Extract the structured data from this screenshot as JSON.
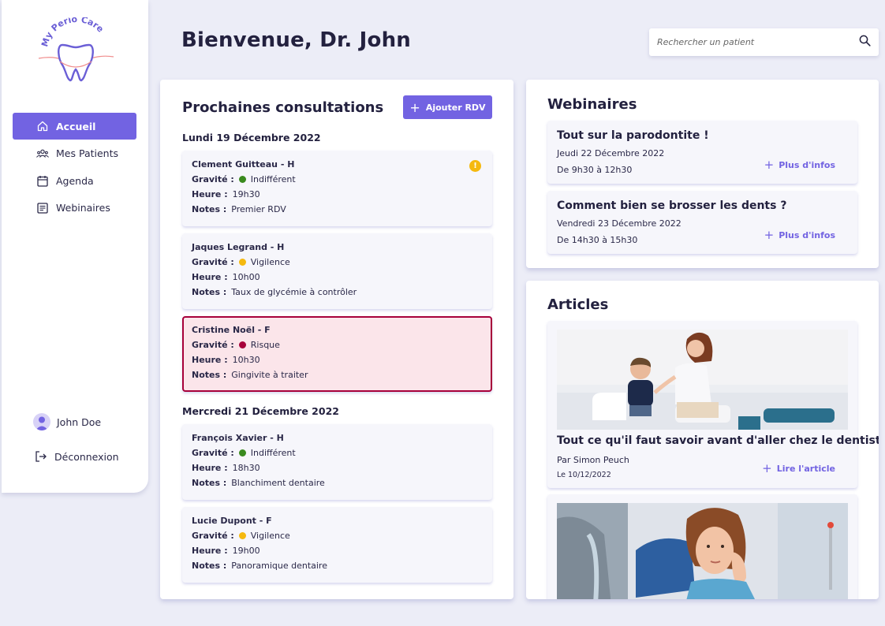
{
  "app": {
    "logo_text": "My Perio Care"
  },
  "sidebar": {
    "items": [
      {
        "label": "Accueil",
        "icon": "home-icon",
        "active": true
      },
      {
        "label": "Mes Patients",
        "icon": "patients-icon",
        "active": false
      },
      {
        "label": "Agenda",
        "icon": "calendar-icon",
        "active": false
      },
      {
        "label": "Webinaires",
        "icon": "document-icon",
        "active": false
      }
    ],
    "user_name": "John Doe",
    "logout_label": "Déconnexion"
  },
  "header": {
    "title": "Bienvenue, Dr. John",
    "search_placeholder": "Rechercher un patient"
  },
  "consultations": {
    "title": "Prochaines consultations",
    "add_button": "Ajouter RDV",
    "labels": {
      "gravity": "Gravité :",
      "hour": "Heure :",
      "notes": "Notes :"
    },
    "days": [
      {
        "label": "Lundi 19 Décembre 2022",
        "items": [
          {
            "name": "Clement Guitteau - H",
            "gravity": "Indifférent",
            "gravity_color": "#3a8a1e",
            "hour": "19h30",
            "notes": "Premier RDV",
            "warning": true
          },
          {
            "name": "Jaques Legrand - H",
            "gravity": "Vigilence",
            "gravity_color": "#f5b90f",
            "hour": "10h00",
            "notes": "Taux de glycémie à contrôler",
            "warning": false
          },
          {
            "name": "Cristine Noël - F",
            "gravity": "Risque",
            "gravity_color": "#a7003a",
            "hour": "10h30",
            "notes": "Gingivite à traiter",
            "warning": false,
            "alert": true
          }
        ]
      },
      {
        "label": "Mercredi 21 Décembre 2022",
        "items": [
          {
            "name": "François Xavier - H",
            "gravity": "Indifférent",
            "gravity_color": "#3a8a1e",
            "hour": "18h30",
            "notes": "Blanchiment dentaire"
          },
          {
            "name": "Lucie Dupont - F",
            "gravity": "Vigilence",
            "gravity_color": "#f5b90f",
            "hour": "19h00",
            "notes": "Panoramique dentaire"
          }
        ]
      }
    ]
  },
  "webinars": {
    "title": "Webinaires",
    "more_label": "Plus d'infos",
    "items": [
      {
        "title": "Tout sur la parodontite !",
        "date": "Jeudi 22 Décembre 2022",
        "time": "De 9h30 à 12h30"
      },
      {
        "title": "Comment bien se brosser les dents ?",
        "date": "Vendredi 23 Décembre 2022",
        "time": "De 14h30 à 15h30"
      }
    ]
  },
  "articles": {
    "title": "Articles",
    "read_label": "Lire l'article",
    "items": [
      {
        "title": "Tout ce qu'il faut savoir avant d'aller chez le dentiste",
        "author": "Par Simon Peuch",
        "date": "Le 10/12/2022"
      },
      {
        "title": "",
        "author": "",
        "date": ""
      }
    ]
  },
  "colors": {
    "accent": "#7263e2",
    "alert": "#a7003a",
    "warning": "#f5b90f",
    "ok": "#3a8a1e",
    "background": "#ecedf7"
  }
}
